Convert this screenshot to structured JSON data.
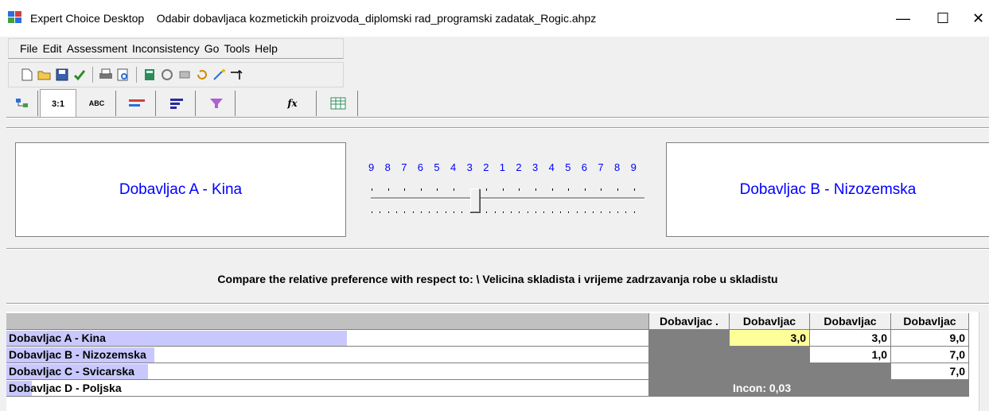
{
  "window": {
    "app_name": "Expert Choice Desktop",
    "file_name": "Odabir dobavljaca kozmetickih proizvoda_diplomski rad_programski zadatak_Rogic.ahpz",
    "minimize_glyph": "—",
    "maximize_glyph": "☐",
    "close_glyph": "✕"
  },
  "menu": {
    "items": [
      "File",
      "Edit",
      "Assessment",
      "Inconsistency",
      "Go",
      "Tools",
      "Help"
    ]
  },
  "toolbar": {
    "icons": [
      "new-document-icon",
      "open-folder-icon",
      "save-icon",
      "check-icon",
      "print-icon",
      "print-preview-icon",
      "calculator-icon",
      "network-icon",
      "eraser-icon",
      "refresh-icon",
      "wand-icon",
      "arrow-up-icon"
    ]
  },
  "tabs": {
    "items": [
      {
        "label": "",
        "icon": "tree-icon"
      },
      {
        "label": "3:1",
        "icon": ""
      },
      {
        "label": "ABC",
        "icon": ""
      },
      {
        "label": "",
        "icon": "bar-compare-icon"
      },
      {
        "label": "",
        "icon": "bars-icon"
      },
      {
        "label": "",
        "icon": "hierarchy-icon"
      },
      {
        "label": "fx",
        "icon": "formula-icon"
      },
      {
        "label": "",
        "icon": "grid-icon"
      }
    ],
    "active_index": 1
  },
  "comparison": {
    "left_alternative": "Dobavljac A - Kina",
    "right_alternative": "Dobavljac B - Nizozemska",
    "scale": [
      "9",
      "8",
      "7",
      "6",
      "5",
      "4",
      "3",
      "2",
      "1",
      "2",
      "3",
      "4",
      "5",
      "6",
      "7",
      "8",
      "9"
    ],
    "slider_value": 3,
    "slider_side": "left",
    "prompt": "Compare the relative preference with respect to:  \\ Velicina skladista i vrijeme zadrzavanja robe u skladistu"
  },
  "matrix": {
    "column_headers": [
      "Dobavljac .",
      "Dobavljac",
      "Dobavljac",
      "Dobavljac"
    ],
    "rows": [
      {
        "label": "Dobavljac A - Kina",
        "bar": 0.53,
        "cells": [
          "",
          "3,0",
          "3,0",
          "9,0"
        ],
        "types": [
          "gray",
          "yellow",
          "white",
          "white"
        ]
      },
      {
        "label": "Dobavljac B - Nizozemska",
        "bar": 0.23,
        "cells": [
          "",
          "",
          "1,0",
          "7,0"
        ],
        "types": [
          "gray",
          "gray",
          "white",
          "white"
        ]
      },
      {
        "label": "Dobavljac C - Svicarska",
        "bar": 0.22,
        "cells": [
          "",
          "",
          "",
          "7,0"
        ],
        "types": [
          "gray",
          "gray",
          "gray",
          "white"
        ]
      },
      {
        "label": "Dobavljac D - Poljska",
        "bar": 0.04,
        "cells": [
          "",
          "Incon: 0,03",
          "",
          ""
        ],
        "types": [
          "gray",
          "gray",
          "gray",
          "gray"
        ]
      }
    ]
  },
  "colors": {
    "accent_blue": "#0000ff",
    "highlight_yellow": "#ffff99",
    "priority_bar": "#c8c8ff",
    "gray_cell": "#808080"
  }
}
